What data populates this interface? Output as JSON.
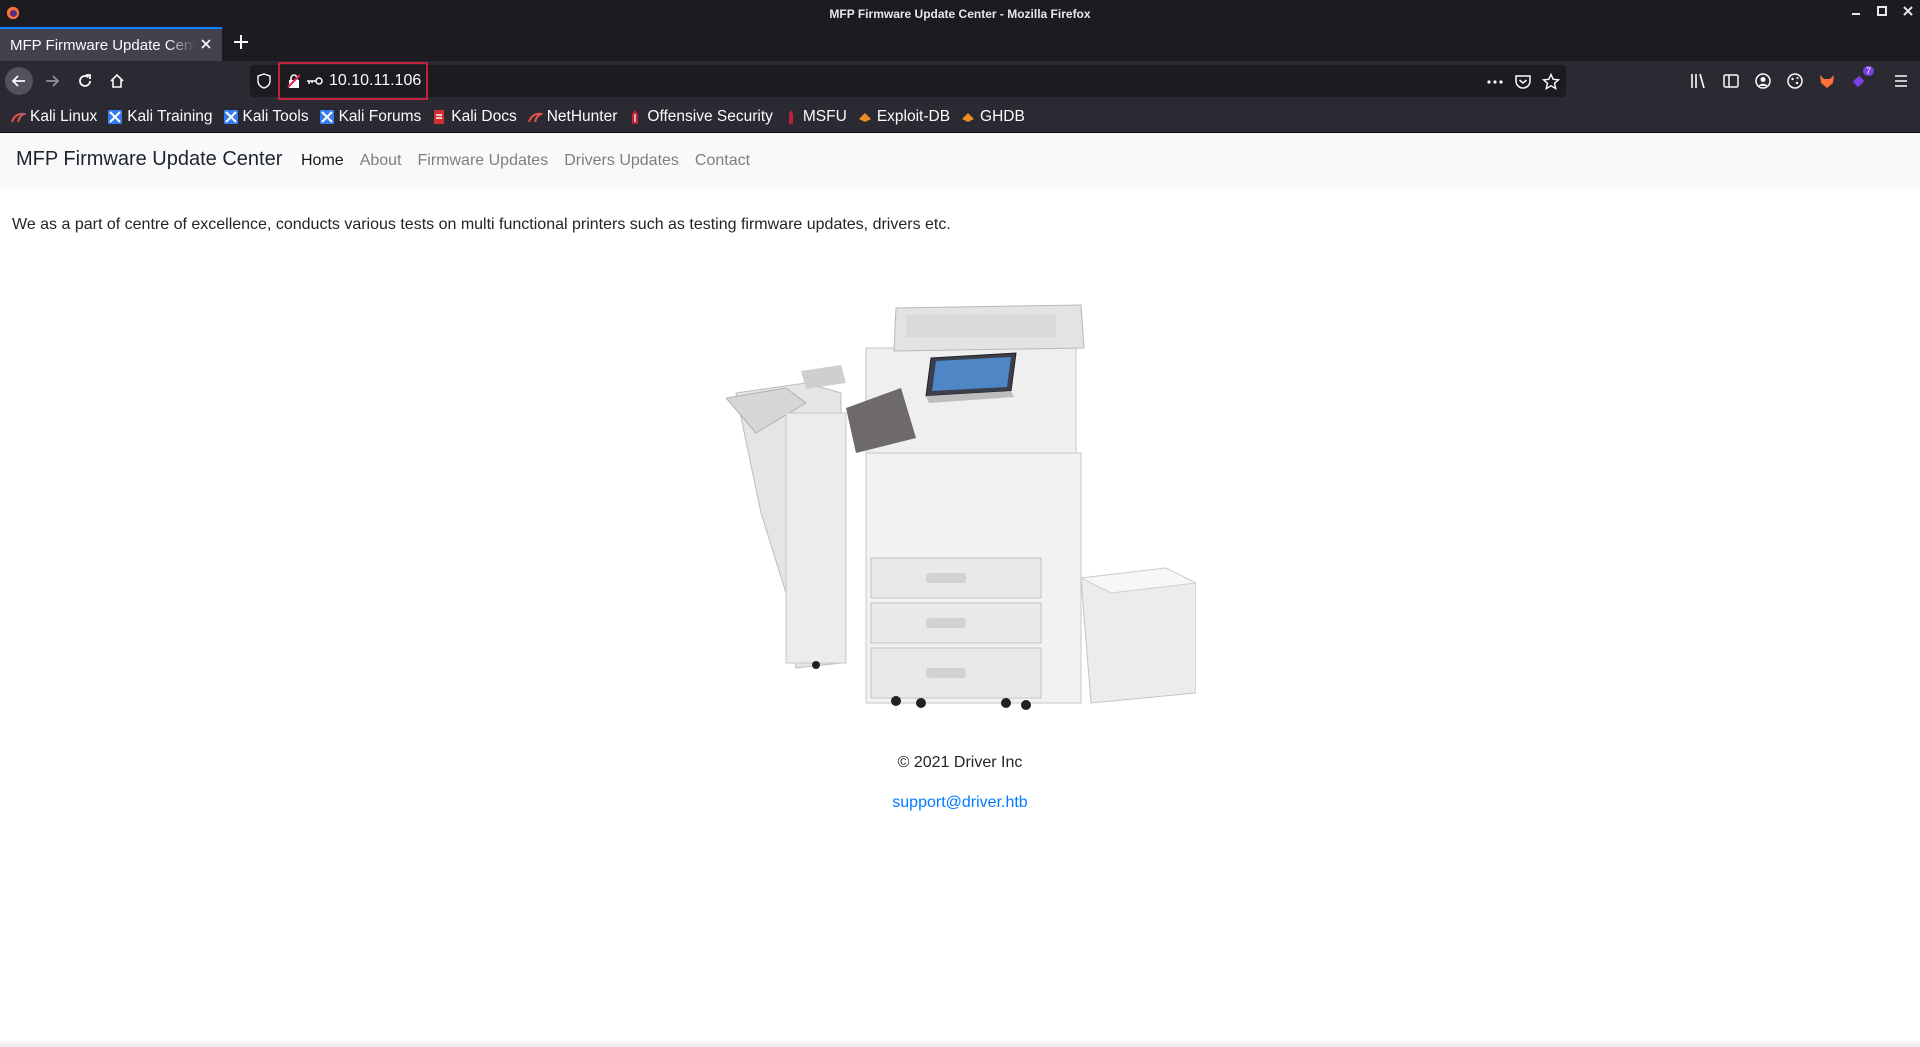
{
  "window": {
    "title": "MFP Firmware Update Center - Mozilla Firefox"
  },
  "tabs": [
    {
      "label": "MFP Firmware Update Center"
    }
  ],
  "urlbar": {
    "url": "10.10.11.106"
  },
  "bookmarks": [
    {
      "label": "Kali Linux",
      "icon": "kali-dragon-icon"
    },
    {
      "label": "Kali Training",
      "icon": "kali-training-icon"
    },
    {
      "label": "Kali Tools",
      "icon": "kali-tools-icon"
    },
    {
      "label": "Kali Forums",
      "icon": "kali-forums-icon"
    },
    {
      "label": "Kali Docs",
      "icon": "kali-docs-icon"
    },
    {
      "label": "NetHunter",
      "icon": "nethunter-icon"
    },
    {
      "label": "Offensive Security",
      "icon": "offsec-icon"
    },
    {
      "label": "MSFU",
      "icon": "msfu-icon"
    },
    {
      "label": "Exploit-DB",
      "icon": "exploit-db-icon"
    },
    {
      "label": "GHDB",
      "icon": "ghdb-icon"
    }
  ],
  "site": {
    "brand": "MFP Firmware Update Center",
    "nav": [
      {
        "label": "Home",
        "active": true
      },
      {
        "label": "About",
        "active": false
      },
      {
        "label": "Firmware Updates",
        "active": false
      },
      {
        "label": "Drivers Updates",
        "active": false
      },
      {
        "label": "Contact",
        "active": false
      }
    ],
    "intro": "We as a part of centre of excellence, conducts various tests on multi functional printers such as testing firmware updates, drivers etc.",
    "footer_copyright": "© 2021 Driver Inc",
    "support_email": "support@driver.htb"
  },
  "toolbar": {
    "extension_badge": "7"
  },
  "colors": {
    "chrome_dark": "#1c1b22",
    "tab_active": "#42414d",
    "navbar": "#2b2a33",
    "url_highlight": "#c0223d",
    "link": "#007bff",
    "site_nav_bg": "#f8f9fa"
  }
}
